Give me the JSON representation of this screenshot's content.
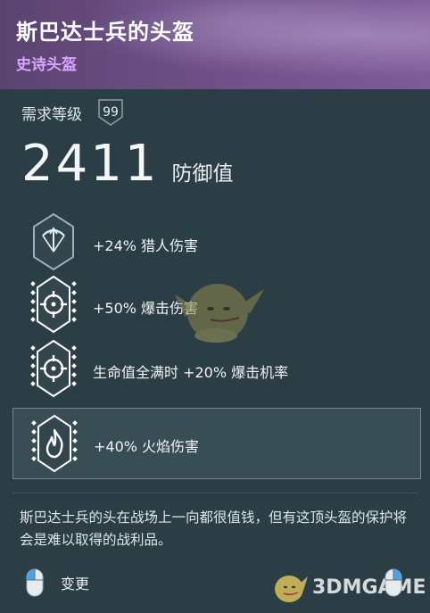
{
  "item": {
    "name": "斯巴达士兵的头盔",
    "rarity": "史诗头盔"
  },
  "requirement": {
    "label": "需求等级",
    "level": "99"
  },
  "defense": {
    "value": "2411",
    "label": "防御值"
  },
  "perks": [
    {
      "text": "+24% 猎人伤害",
      "icon": "bow-icon"
    },
    {
      "text": "+50% 爆击伤害",
      "icon": "crosshair-icon"
    },
    {
      "text": "生命值全满时 +20% 爆击机率",
      "icon": "crosshair-icon"
    },
    {
      "text": "+40% 火焰伤害",
      "icon": "flame-icon",
      "highlighted": true
    }
  ],
  "description": "斯巴达士兵的头在战场上一向都很值钱，但有这顶头盔的保护将会是难以取得的战利品。",
  "actions": {
    "change_label": "变更"
  },
  "watermark": {
    "text": "3DMGAME"
  },
  "colors": {
    "panel_bg": "#2b3d45",
    "header_purple": "#6d4f86",
    "rarity_text": "#d8a6ff"
  }
}
